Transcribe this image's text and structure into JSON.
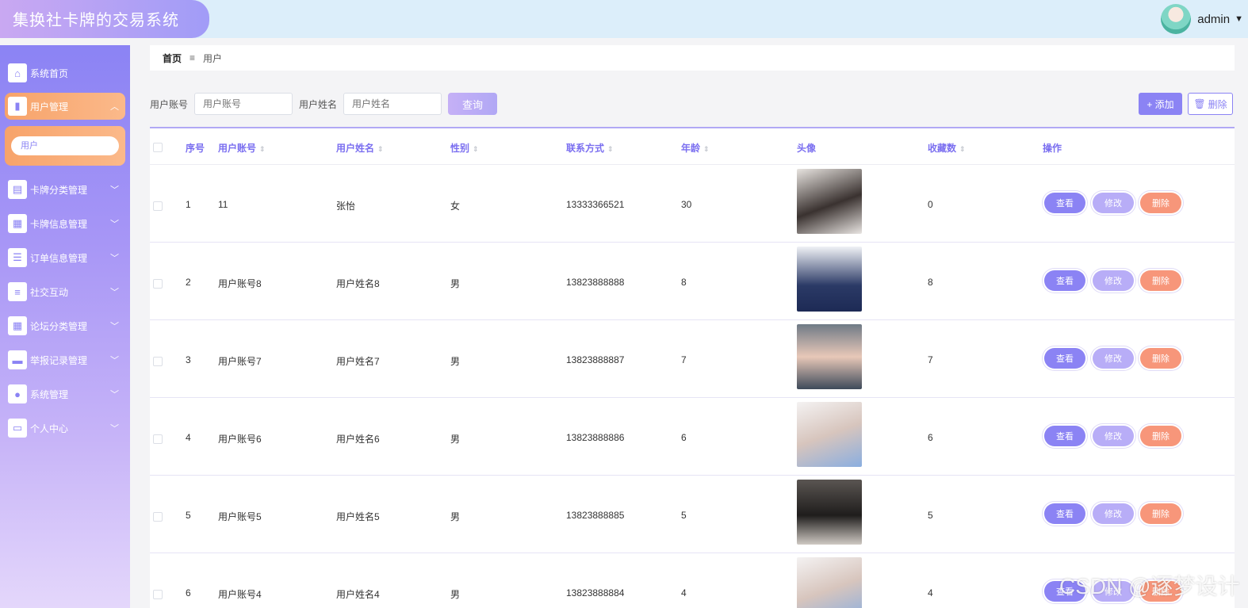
{
  "app": {
    "title": "集换社卡牌的交易系统"
  },
  "user": {
    "name": "admin"
  },
  "sidebar": {
    "items": [
      {
        "label": "系统首页",
        "icon": "home-icon"
      },
      {
        "label": "用户管理",
        "icon": "users-icon",
        "active": true
      },
      {
        "label": "卡牌分类管理",
        "icon": "clipboard-icon"
      },
      {
        "label": "卡牌信息管理",
        "icon": "grid-icon"
      },
      {
        "label": "订单信息管理",
        "icon": "sliders-icon"
      },
      {
        "label": "社交互动",
        "icon": "list-icon"
      },
      {
        "label": "论坛分类管理",
        "icon": "grid-icon"
      },
      {
        "label": "举报记录管理",
        "icon": "chat-icon"
      },
      {
        "label": "系统管理",
        "icon": "person-icon"
      },
      {
        "label": "个人中心",
        "icon": "card-icon"
      }
    ],
    "submenu": {
      "label": "用户"
    }
  },
  "breadcrumb": {
    "home": "首页",
    "separator": "≡",
    "current": "用户"
  },
  "search": {
    "account_label": "用户账号",
    "account_placeholder": "用户账号",
    "name_label": "用户姓名",
    "name_placeholder": "用户姓名",
    "query_button": "查询"
  },
  "actions": {
    "add": "+ 添加",
    "delete": "删除"
  },
  "table": {
    "columns": [
      "序号",
      "用户账号",
      "用户姓名",
      "性别",
      "联系方式",
      "年龄",
      "头像",
      "收藏数",
      "操作"
    ],
    "rows": [
      {
        "index": "1",
        "account": "11",
        "name": "张怡",
        "gender": "女",
        "phone": "13333366521",
        "age": "30",
        "favorites": "0"
      },
      {
        "index": "2",
        "account": "用户账号8",
        "name": "用户姓名8",
        "gender": "男",
        "phone": "13823888888",
        "age": "8",
        "favorites": "8"
      },
      {
        "index": "3",
        "account": "用户账号7",
        "name": "用户姓名7",
        "gender": "男",
        "phone": "13823888887",
        "age": "7",
        "favorites": "7"
      },
      {
        "index": "4",
        "account": "用户账号6",
        "name": "用户姓名6",
        "gender": "男",
        "phone": "13823888886",
        "age": "6",
        "favorites": "6"
      },
      {
        "index": "5",
        "account": "用户账号5",
        "name": "用户姓名5",
        "gender": "男",
        "phone": "13823888885",
        "age": "5",
        "favorites": "5"
      },
      {
        "index": "6",
        "account": "用户账号4",
        "name": "用户姓名4",
        "gender": "男",
        "phone": "13823888884",
        "age": "4",
        "favorites": "4"
      }
    ],
    "row_actions": {
      "view": "查看",
      "edit": "修改",
      "delete": "删除"
    }
  },
  "watermark": "CSDN @逐梦设计",
  "colors": {
    "primary": "#8b83f4",
    "accent": "#f7a36a",
    "danger": "#f7967a",
    "header_bg": "#dceefa"
  }
}
